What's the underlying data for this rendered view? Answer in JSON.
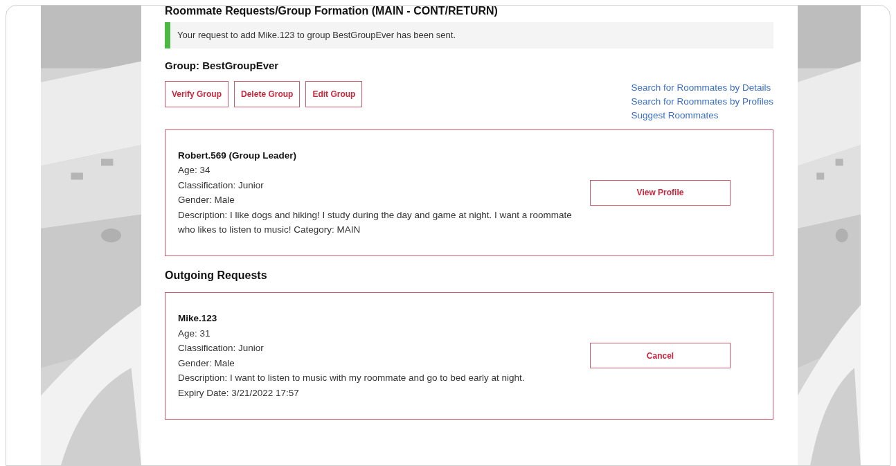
{
  "page_title": "Roommate Requests/Group Formation (MAIN - CONT/RETURN)",
  "alert": {
    "text": "Your request to add Mike.123 to group BestGroupEver has been sent."
  },
  "group": {
    "title": "Group: BestGroupEver",
    "buttons": [
      "Verify Group",
      "Delete Group",
      "Edit Group"
    ],
    "links": [
      "Search for Roommates by Details",
      "Search for Roommates by Profiles",
      "Suggest Roommates"
    ],
    "members": [
      {
        "name": "Robert.569 (Group Leader)",
        "details": [
          "Age: 34",
          "Classification: Junior",
          "Gender: Male",
          "Description: I like dogs and hiking! I study during the day and game at night. I want a roommate who likes to listen to music! Category: MAIN"
        ],
        "action": "View Profile"
      }
    ]
  },
  "outgoing": {
    "heading": "Outgoing Requests",
    "requests": [
      {
        "name": "Mike.123",
        "details": [
          "Age: 31",
          "Classification: Junior",
          "Gender: Male",
          "Description: I want to listen to music with my roommate and go to bed early at night.",
          "Expiry Date: 3/21/2022 17:57"
        ],
        "action": "Cancel"
      }
    ]
  }
}
